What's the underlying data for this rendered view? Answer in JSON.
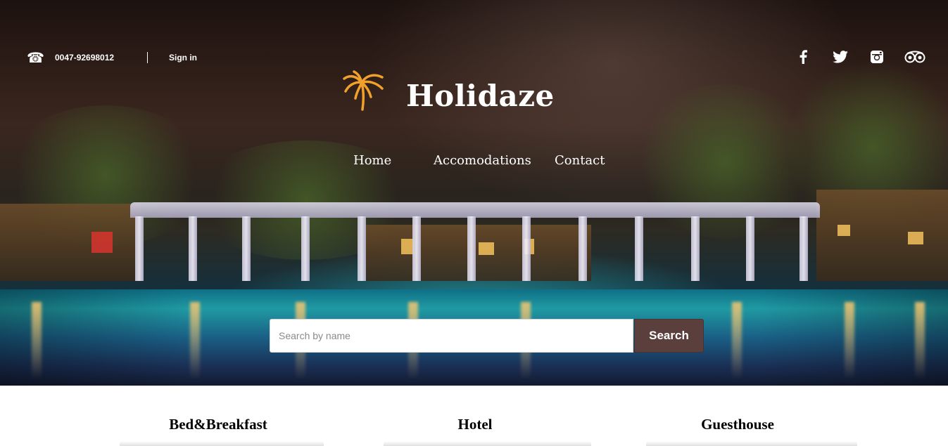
{
  "header": {
    "phone_icon": "phone-icon",
    "phone_number": "0047-92698012",
    "sign_in_label": "Sign in",
    "social": [
      "facebook-icon",
      "twitter-icon",
      "instagram-icon",
      "tripadvisor-icon"
    ]
  },
  "brand": {
    "name": "Holidaze",
    "logo_icon": "palm-tree-icon",
    "logo_color": "#f2a02c"
  },
  "nav": {
    "items": [
      {
        "label": "Home"
      },
      {
        "label": "Accomodations"
      },
      {
        "label": "Contact"
      }
    ]
  },
  "search": {
    "placeholder": "Search by name",
    "value": "",
    "button_label": "Search",
    "button_color": "#5b3f3d"
  },
  "categories": [
    {
      "label": "Bed&Breakfast"
    },
    {
      "label": "Hotel"
    },
    {
      "label": "Guesthouse"
    }
  ]
}
